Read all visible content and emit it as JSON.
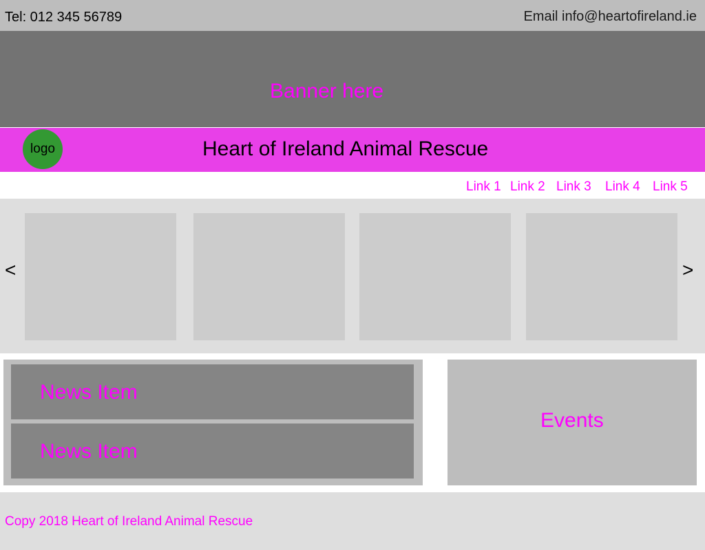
{
  "header": {
    "tel": "Tel: 012 345 56789",
    "email": "Email info@heartofireland.ie"
  },
  "banner": {
    "text": "Banner here"
  },
  "brand": {
    "logo_label": "logo",
    "site_title": "Heart of Ireland Animal Rescue"
  },
  "nav": {
    "links": [
      "Link 1",
      "Link 2",
      "Link 3",
      "Link 4",
      "Link 5"
    ]
  },
  "carousel": {
    "prev_label": "<",
    "next_label": ">",
    "slide_count": 4
  },
  "news": {
    "items": [
      "News Item",
      "News Item"
    ]
  },
  "events": {
    "label": "Events"
  },
  "footer": {
    "copyright": "Copy 2018 Heart of Ireland Animal Rescue"
  },
  "colors": {
    "accent": "#ff00ff",
    "title_bar": "#e840e8",
    "logo": "#339933"
  }
}
